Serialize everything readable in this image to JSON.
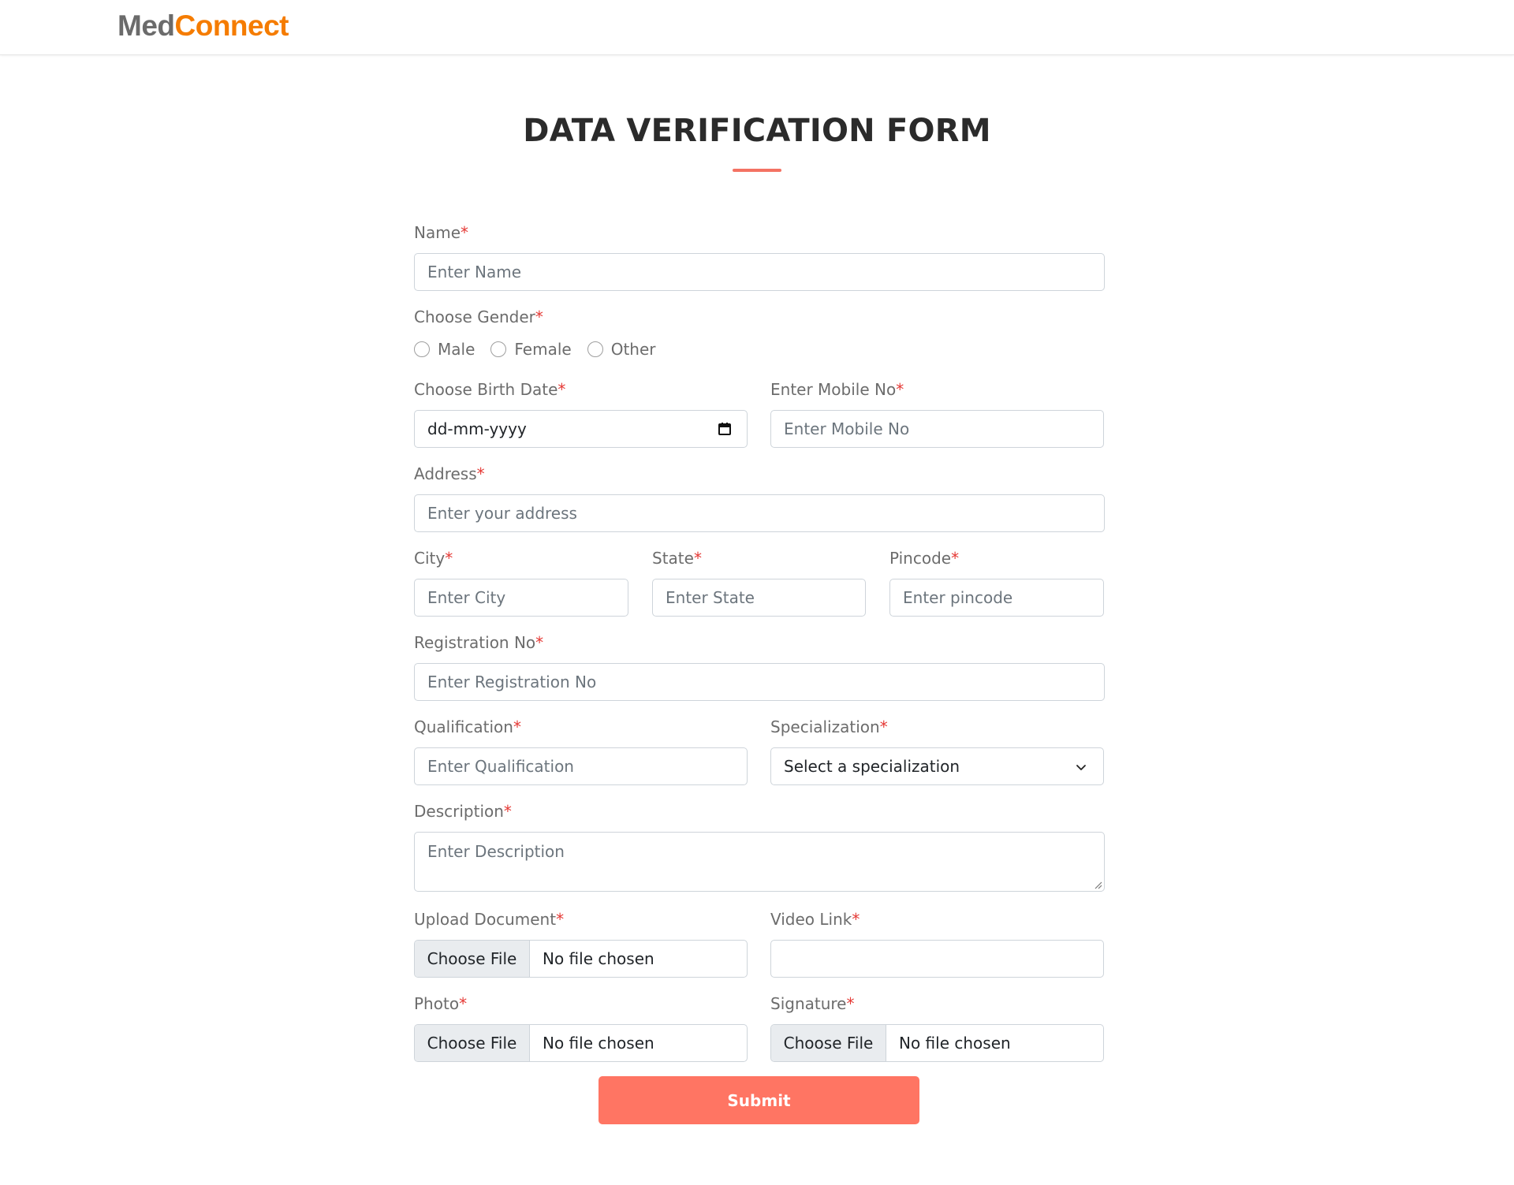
{
  "brand": {
    "part1": "Med",
    "part2": "Connect"
  },
  "form_title": "DATA VERIFICATION FORM",
  "required_mark": "*",
  "name": {
    "label": "Name",
    "placeholder": "Enter Name"
  },
  "gender": {
    "label": "Choose Gender",
    "options": [
      "Male",
      "Female",
      "Other"
    ]
  },
  "birth_date": {
    "label": "Choose Birth Date",
    "value": "dd-mm-yyyy"
  },
  "mobile": {
    "label": "Enter Mobile No",
    "placeholder": "Enter Mobile No"
  },
  "address": {
    "label": "Address",
    "placeholder": "Enter your address"
  },
  "city": {
    "label": "City",
    "placeholder": "Enter City"
  },
  "state": {
    "label": "State",
    "placeholder": "Enter State"
  },
  "pincode": {
    "label": "Pincode",
    "placeholder": "Enter pincode"
  },
  "registration": {
    "label": "Registration No",
    "placeholder": "Enter Registration No"
  },
  "qualification": {
    "label": "Qualification",
    "placeholder": "Enter Qualification"
  },
  "specialization": {
    "label": "Specialization",
    "selected": "Select a specialization"
  },
  "description": {
    "label": "Description",
    "placeholder": "Enter Description"
  },
  "upload_document": {
    "label": "Upload Document",
    "button": "Choose File",
    "status": "No file chosen"
  },
  "video_link": {
    "label": "Video Link",
    "value": ""
  },
  "photo": {
    "label": "Photo",
    "button": "Choose File",
    "status": "No file chosen"
  },
  "signature": {
    "label": "Signature",
    "button": "Choose File",
    "status": "No file chosen"
  },
  "submit_label": "Submit",
  "colors": {
    "brand_gray": "#6b6b6b",
    "brand_orange": "#f57c00",
    "accent": "#ff7563",
    "required": "#e53935"
  },
  "icons": {
    "date": "calendar-icon",
    "select": "chevron-down-icon",
    "textarea": "resize-handle-icon"
  }
}
